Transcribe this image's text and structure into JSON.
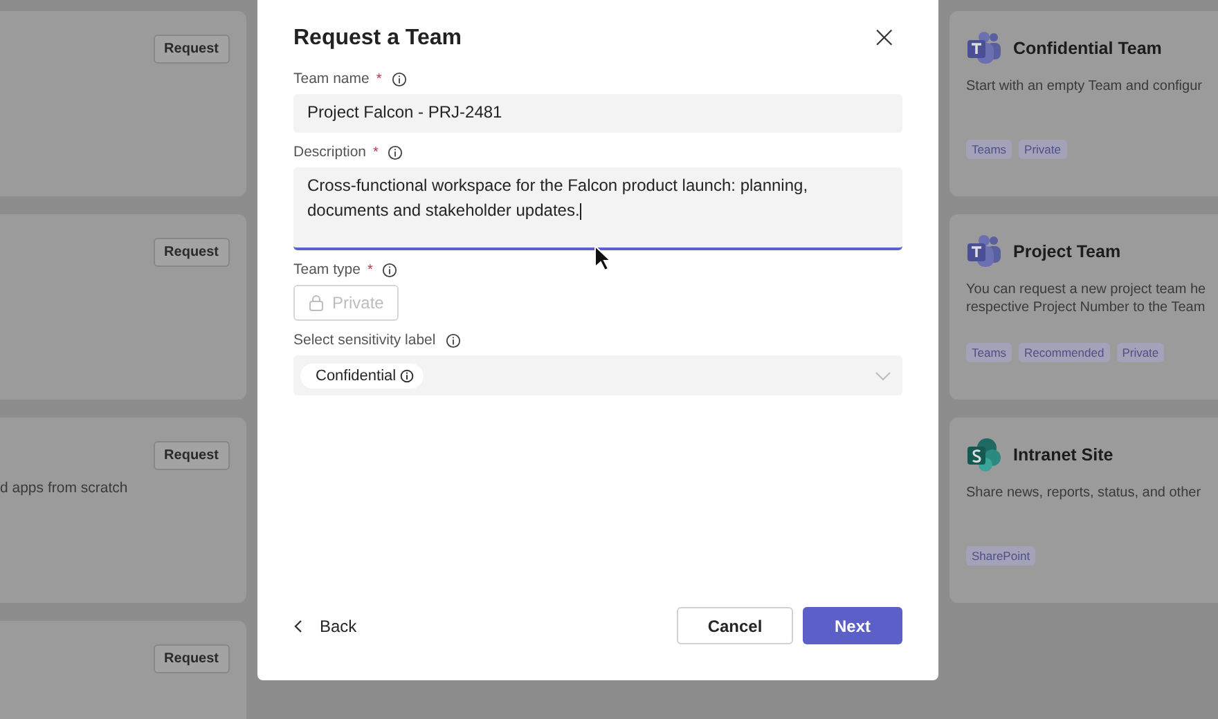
{
  "left_cards": [
    {
      "button": "Request"
    },
    {
      "button": "Request"
    },
    {
      "button": "Request",
      "description": "d apps from scratch"
    },
    {
      "button": "Request"
    }
  ],
  "right_cards": [
    {
      "kind": "teams",
      "title": "Confidential Team",
      "description": [
        "Start with an empty Team and configur"
      ],
      "tags": [
        "Teams",
        "Private"
      ]
    },
    {
      "kind": "teams",
      "title": "Project Team",
      "description": [
        "You can request a new project team he",
        "respective Project Number to the Team"
      ],
      "tags": [
        "Teams",
        "Recommended",
        "Private"
      ]
    },
    {
      "kind": "sharepoint",
      "title": "Intranet Site",
      "description": [
        "Share news, reports, status, and other"
      ],
      "tags": [
        "SharePoint"
      ]
    }
  ],
  "dialog": {
    "title": "Request a Team",
    "close": "×",
    "fields": [
      {
        "kind": "text",
        "label": "Team name",
        "required_mark": "*",
        "value": "Project Falcon - PRJ-2481",
        "focused": false
      },
      {
        "kind": "textarea",
        "label": "Description",
        "required_mark": "*",
        "value": "Cross-functional workspace for the Falcon product launch: planning, documents and stakeholder updates.",
        "focused": true
      },
      {
        "kind": "toggle",
        "label": "Team type",
        "required_mark": "*",
        "value": "Private",
        "disabled": true
      },
      {
        "kind": "select",
        "label": "Select sensitivity label",
        "value": "Confidential"
      }
    ],
    "back": "Back",
    "cancel": "Cancel",
    "next": "Next"
  }
}
